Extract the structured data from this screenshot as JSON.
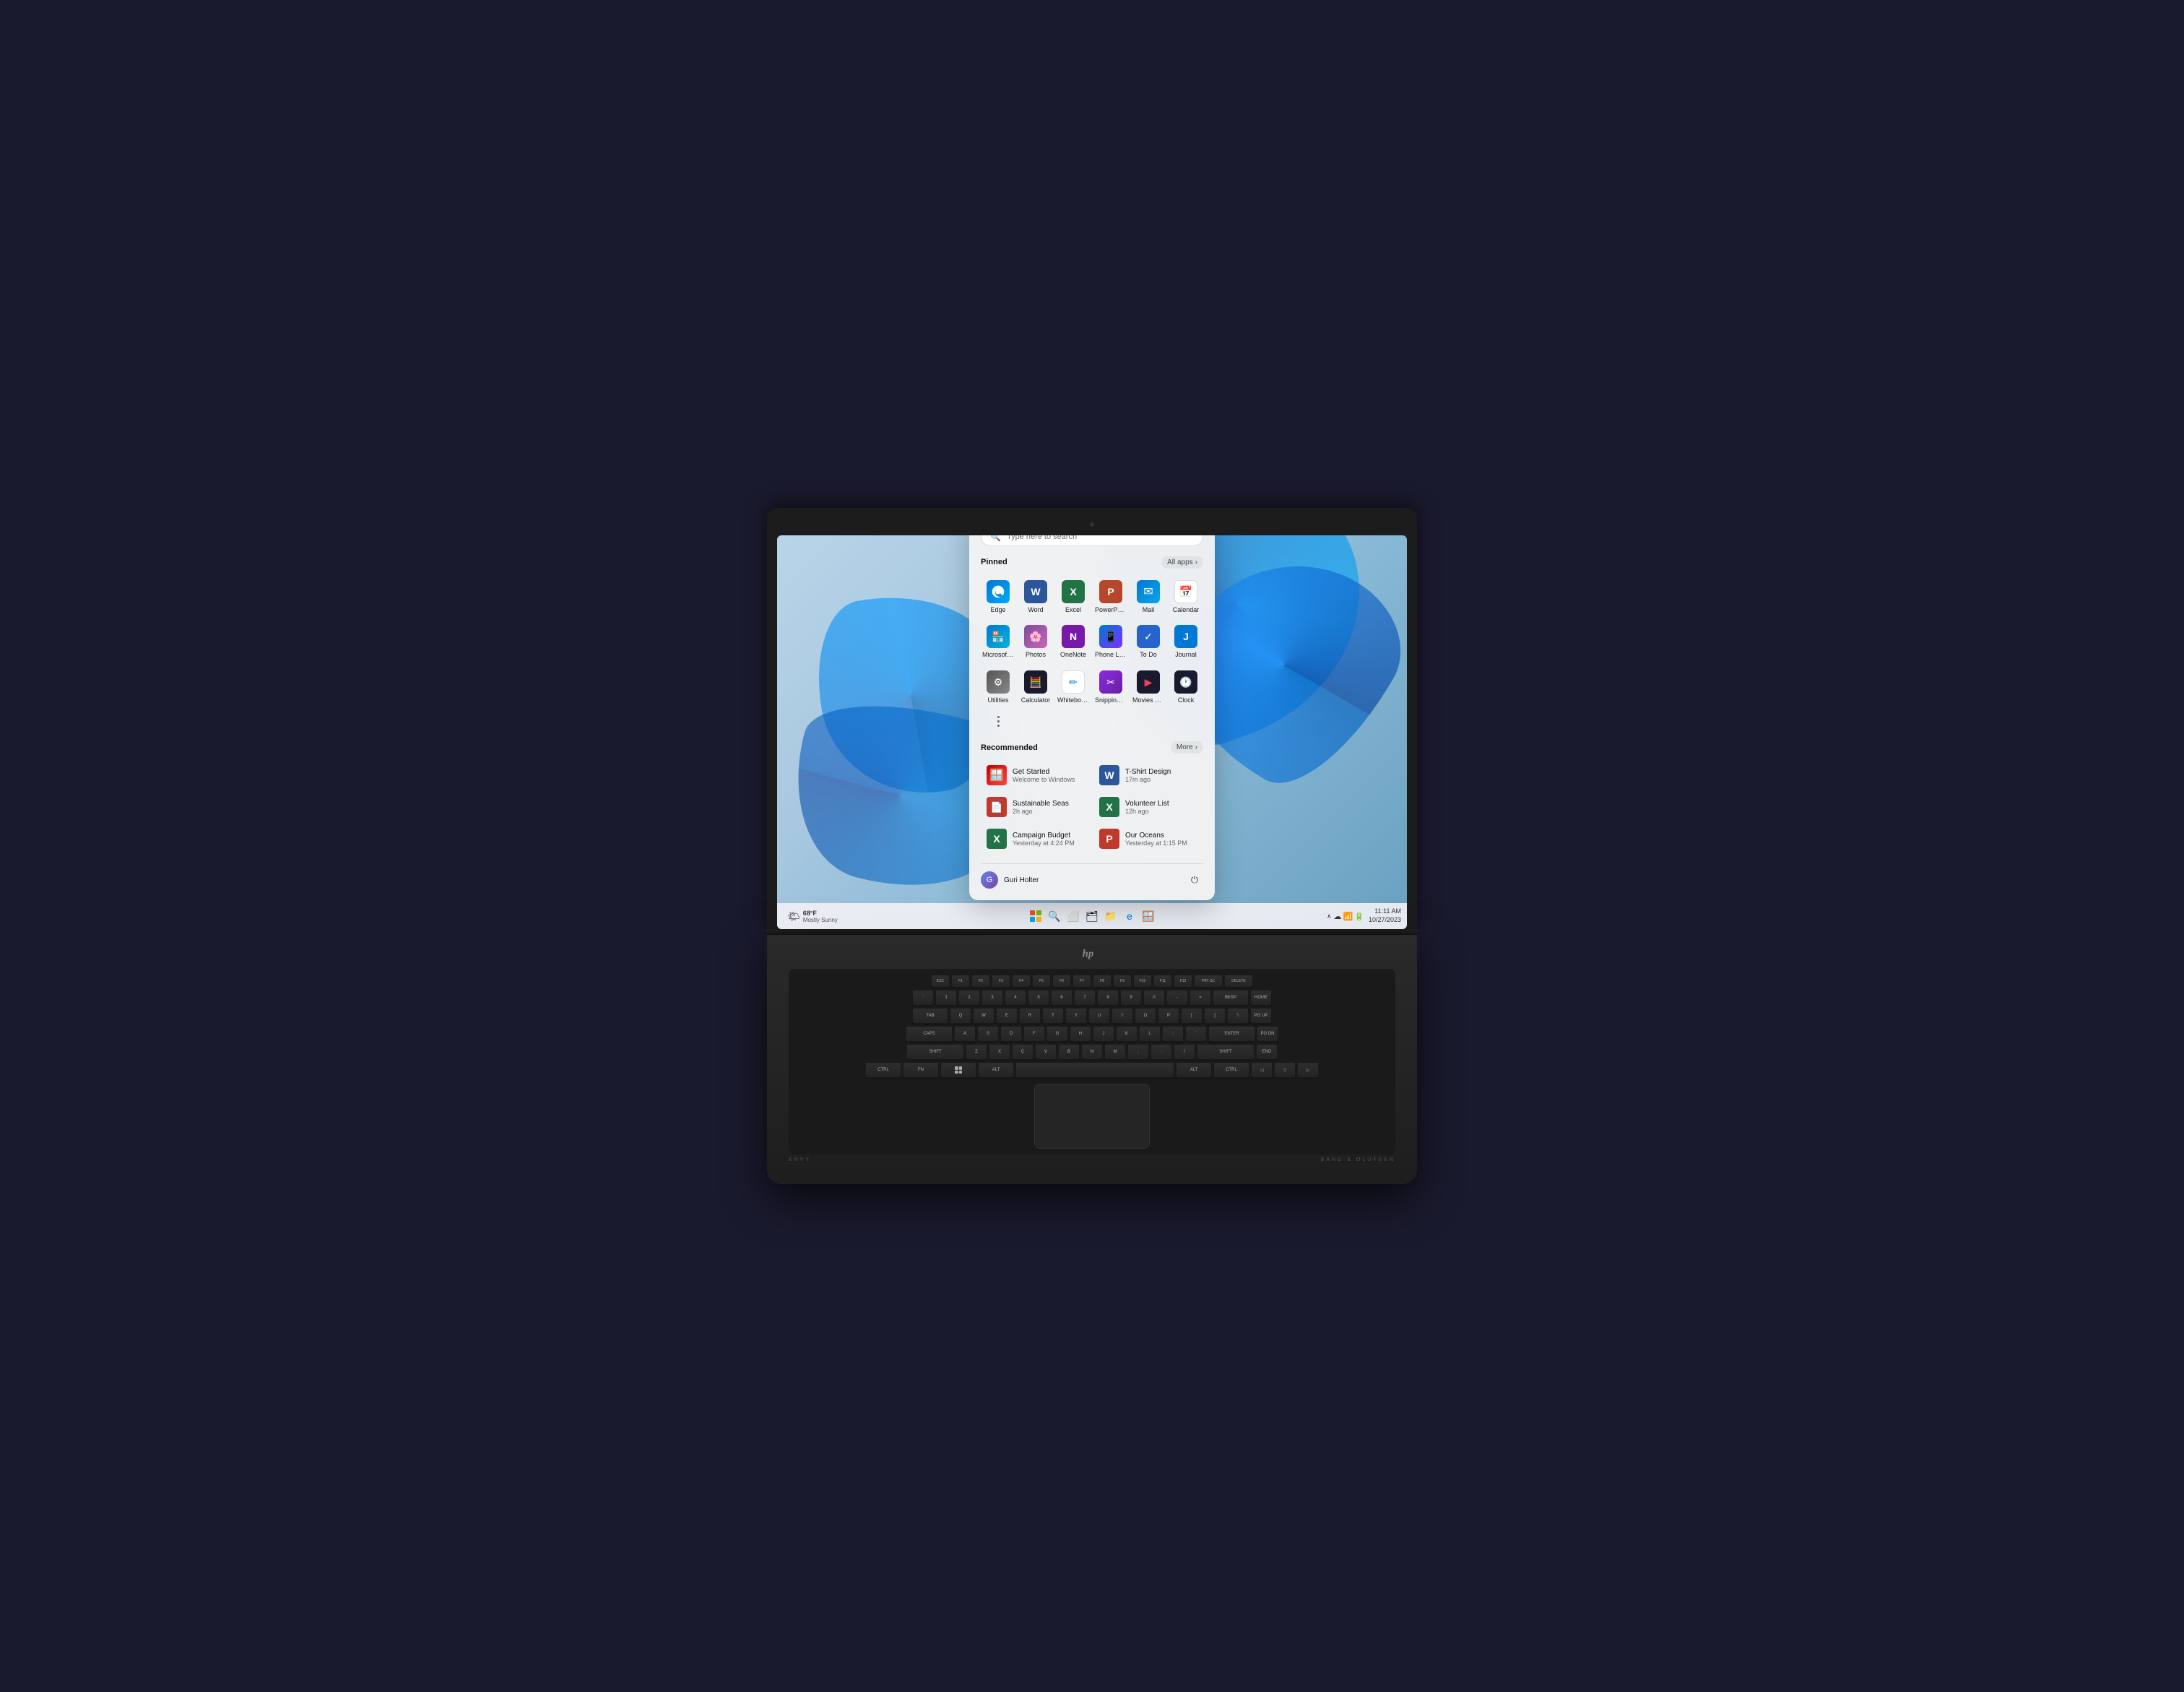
{
  "laptop": {
    "brand": "hp",
    "series": "ENVY",
    "audio": "BANG & OLUFSEN"
  },
  "screen": {
    "wallpaper": "Windows 11 blue bloom"
  },
  "taskbar": {
    "weather": {
      "temp": "68°F",
      "condition": "Mostly Sunny",
      "icon": "🌤"
    },
    "datetime": {
      "time": "11:11 AM",
      "date": "10/27/2023"
    }
  },
  "startmenu": {
    "search_placeholder": "Type here to search",
    "pinned_label": "Pinned",
    "all_apps_label": "All apps",
    "recommended_label": "Recommended",
    "more_label": "More",
    "username": "Guri Holter",
    "pinned_apps": [
      {
        "id": "edge",
        "label": "Edge",
        "icon": "e",
        "color": "edge"
      },
      {
        "id": "word",
        "label": "Word",
        "icon": "W",
        "color": "word"
      },
      {
        "id": "excel",
        "label": "Excel",
        "icon": "X",
        "color": "excel"
      },
      {
        "id": "powerpoint",
        "label": "PowerPoint",
        "icon": "P",
        "color": "powerpoint"
      },
      {
        "id": "mail",
        "label": "Mail",
        "icon": "✉",
        "color": "mail"
      },
      {
        "id": "calendar",
        "label": "Calendar",
        "icon": "📅",
        "color": "calendar"
      },
      {
        "id": "ms-store",
        "label": "Microsoft Store",
        "icon": "🏪",
        "color": "ms-store"
      },
      {
        "id": "photos",
        "label": "Photos",
        "icon": "🌸",
        "color": "photos"
      },
      {
        "id": "onenote",
        "label": "OneNote",
        "icon": "N",
        "color": "onenote"
      },
      {
        "id": "phone-link",
        "label": "Phone Link",
        "icon": "📱",
        "color": "phone-link"
      },
      {
        "id": "todo",
        "label": "To Do",
        "icon": "✓",
        "color": "todo"
      },
      {
        "id": "journal",
        "label": "Journal",
        "icon": "J",
        "color": "journal"
      },
      {
        "id": "utilities",
        "label": "Utilities",
        "icon": "⚙",
        "color": "utilities"
      },
      {
        "id": "calculator",
        "label": "Calculator",
        "icon": "🧮",
        "color": "calculator"
      },
      {
        "id": "whiteboard",
        "label": "Whiteboard",
        "icon": "W",
        "color": "whiteboard"
      },
      {
        "id": "snipping",
        "label": "Snipping Tool",
        "icon": "✂",
        "color": "snipping"
      },
      {
        "id": "movies",
        "label": "Movies & TV",
        "icon": "▶",
        "color": "movies"
      },
      {
        "id": "clock",
        "label": "Clock",
        "icon": "🕐",
        "color": "clock"
      }
    ],
    "recommended_items": [
      {
        "id": "get-started",
        "title": "Get Started",
        "subtitle": "Welcome to Windows",
        "icon": "🪟",
        "color": "get-started"
      },
      {
        "id": "tshirt",
        "title": "T-Shirt Design",
        "subtitle": "17m ago",
        "icon": "W",
        "color": "tshirt"
      },
      {
        "id": "sustainable",
        "title": "Sustainable Seas",
        "subtitle": "2h ago",
        "icon": "📄",
        "color": "sustainable"
      },
      {
        "id": "volunteer",
        "title": "Volunteer List",
        "subtitle": "12h ago",
        "icon": "X",
        "color": "volunteer"
      },
      {
        "id": "campaign",
        "title": "Campaign Budget",
        "subtitle": "Yesterday at 4:24 PM",
        "icon": "X",
        "color": "campaign"
      },
      {
        "id": "oceans",
        "title": "Our Oceans",
        "subtitle": "Yesterday at 1:15 PM",
        "icon": "P",
        "color": "oceans"
      }
    ]
  },
  "keyboard": {
    "fn_row": [
      "ESC",
      "F1",
      "F2",
      "F3",
      "F4",
      "F5",
      "F6",
      "F7",
      "F8",
      "F9",
      "F10",
      "F11",
      "F12",
      "PRT SC",
      "DELETE"
    ],
    "row1": [
      "`",
      "1",
      "2",
      "3",
      "4",
      "5",
      "6",
      "7",
      "8",
      "9",
      "0",
      "-",
      "=",
      "BKSP",
      "HOME"
    ],
    "row2": [
      "TAB",
      "Q",
      "W",
      "E",
      "R",
      "T",
      "Y",
      "U",
      "I",
      "O",
      "P",
      "[",
      "]",
      "\\",
      "PG UP"
    ],
    "row3": [
      "CAPS",
      "A",
      "S",
      "D",
      "F",
      "G",
      "H",
      "J",
      "K",
      "L",
      ";",
      "'",
      "ENTER",
      "PG DN"
    ],
    "row4": [
      "SHIFT",
      "Z",
      "X",
      "C",
      "V",
      "B",
      "N",
      "M",
      ",",
      ".",
      "/",
      "SHIFT",
      "END"
    ],
    "row5": [
      "CTRL",
      "FN",
      "⊞",
      "ALT",
      "SPACE",
      "ALT",
      "CTRL",
      "◁",
      "▽",
      "▷"
    ]
  }
}
